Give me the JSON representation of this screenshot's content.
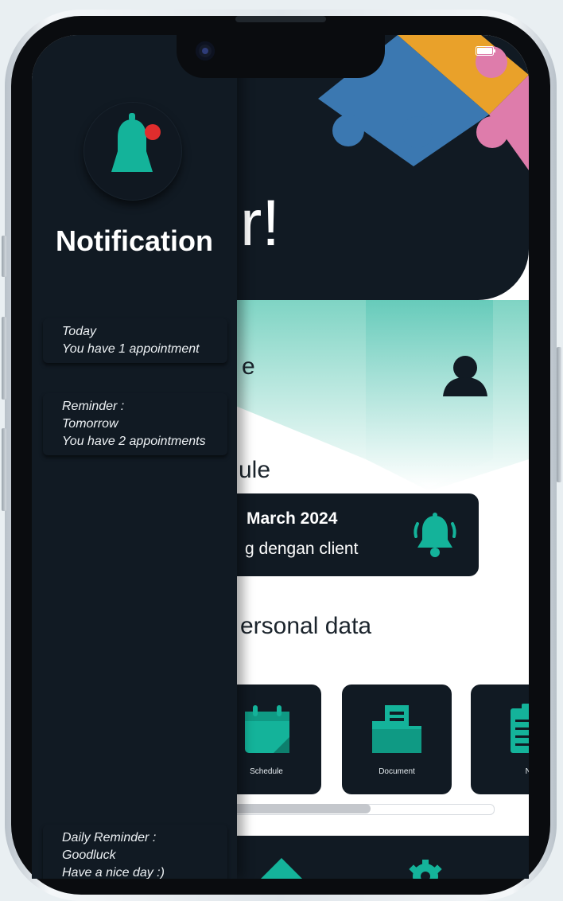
{
  "background": "#e9eff2",
  "colors": {
    "dark": "#111a23",
    "teal": "#14b39a",
    "red": "#e02d2d",
    "puzzle_blue": "#3b78b1",
    "puzzle_orange": "#e9a12a",
    "puzzle_pink": "#de7cab"
  },
  "status_bar": {
    "battery_icon": "battery-icon"
  },
  "main": {
    "greeting_partial": "r!",
    "profile_partial": "e",
    "schedule_title_partial": "ule",
    "schedule_card": {
      "date_partial": "March 2024",
      "desc_partial": "g dengan client"
    },
    "personal_data_partial": "ersonal data",
    "tiles": [
      {
        "label": "Schedule",
        "icon": "calendar-icon"
      },
      {
        "label": "Document",
        "icon": "folder-icon"
      },
      {
        "label": "No",
        "icon": "notepad-icon"
      }
    ],
    "scroll_progress": 0.53,
    "bottom_nav": [
      {
        "icon": "home-icon"
      },
      {
        "icon": "settings-icon"
      }
    ]
  },
  "drawer": {
    "title": "Notification",
    "bell_icon": "bell-icon",
    "notifications": [
      {
        "lines": [
          "Today",
          "You have 1 appointment"
        ]
      },
      {
        "lines": [
          "Reminder :",
          "Tomorrow",
          "You have 2 appointments"
        ]
      },
      {
        "lines": [
          "Daily Reminder :",
          "Goodluck",
          "Have a nice day :)"
        ]
      }
    ]
  }
}
